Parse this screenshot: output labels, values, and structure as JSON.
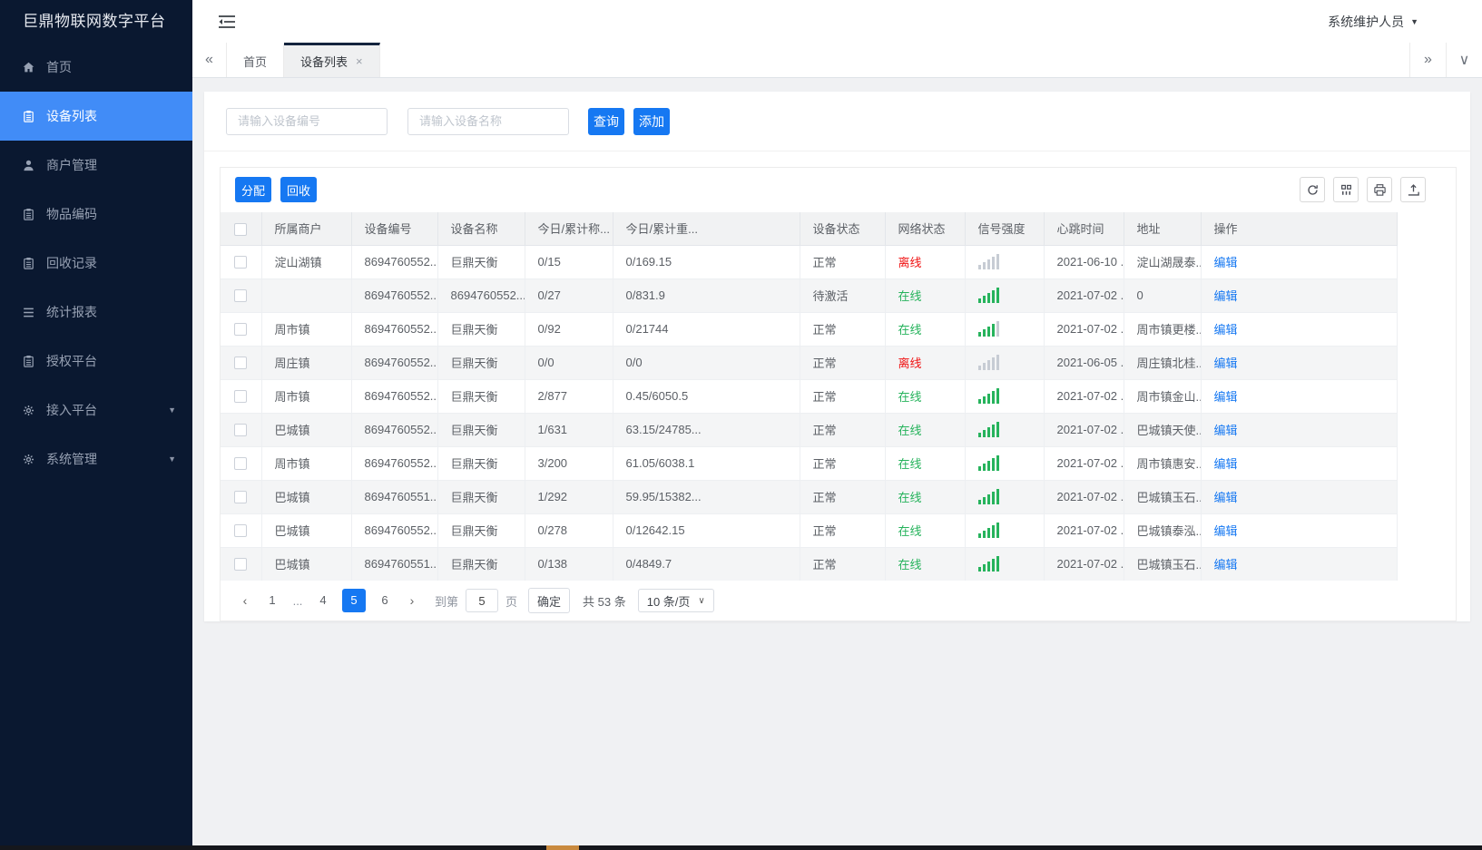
{
  "app_title": "巨鼎物联网数字平台",
  "header": {
    "user": "系统维护人员"
  },
  "glyphs": {
    "tabs_prev": "«",
    "tabs_next": "»",
    "tabs_menu": "∨",
    "page_prev": "‹",
    "page_next": "›",
    "caret_down": "▼",
    "close": "×",
    "select_caret": "∨"
  },
  "sidebar": {
    "items": [
      {
        "key": "home",
        "label": "首页",
        "icon": "home-icon",
        "active": false,
        "expandable": false
      },
      {
        "key": "device-list",
        "label": "设备列表",
        "icon": "clipboard-icon",
        "active": true,
        "expandable": false
      },
      {
        "key": "merchant-mgmt",
        "label": "商户管理",
        "icon": "user-icon",
        "active": false,
        "expandable": false
      },
      {
        "key": "item-code",
        "label": "物品编码",
        "icon": "clipboard-icon",
        "active": false,
        "expandable": false
      },
      {
        "key": "recycle-records",
        "label": "回收记录",
        "icon": "clipboard-icon",
        "active": false,
        "expandable": false
      },
      {
        "key": "stats-report",
        "label": "统计报表",
        "icon": "menu-icon",
        "active": false,
        "expandable": false
      },
      {
        "key": "auth-platform",
        "label": "授权平台",
        "icon": "clipboard-icon",
        "active": false,
        "expandable": false
      },
      {
        "key": "access-platform",
        "label": "接入平台",
        "icon": "gear-icon",
        "active": false,
        "expandable": true
      },
      {
        "key": "system-mgmt",
        "label": "系统管理",
        "icon": "gear-icon",
        "active": false,
        "expandable": true
      }
    ]
  },
  "tabs": [
    {
      "key": "home",
      "label": "首页",
      "active": false,
      "closable": false
    },
    {
      "key": "device-list",
      "label": "设备列表",
      "active": true,
      "closable": true
    }
  ],
  "search": {
    "device_no_placeholder": "请输入设备编号",
    "device_name_placeholder": "请输入设备名称",
    "query_label": "查询",
    "add_label": "添加"
  },
  "toolbar": {
    "assign_label": "分配",
    "recycle_label": "回收"
  },
  "table": {
    "columns": [
      "所属商户",
      "设备编号",
      "设备名称",
      "今日/累计称...",
      "今日/累计重...",
      "设备状态",
      "网络状态",
      "信号强度",
      "心跳时间",
      "地址",
      "操作"
    ],
    "edit_label": "编辑",
    "rows": [
      {
        "merchant": "淀山湖镇",
        "device_no": "8694760552...",
        "device_name": "巨鼎天衡",
        "today_count": "0/15",
        "today_weight": "0/169.15",
        "status": "正常",
        "network": "离线",
        "online": false,
        "signal": 0,
        "heartbeat": "2021-06-10 ...",
        "address": "淀山湖晟泰..."
      },
      {
        "merchant": "",
        "device_no": "8694760552...",
        "device_name": "8694760552...",
        "today_count": "0/27",
        "today_weight": "0/831.9",
        "status": "待激活",
        "network": "在线",
        "online": true,
        "signal": 5,
        "heartbeat": "2021-07-02 ...",
        "address": "0"
      },
      {
        "merchant": "周市镇",
        "device_no": "8694760552...",
        "device_name": "巨鼎天衡",
        "today_count": "0/92",
        "today_weight": "0/21744",
        "status": "正常",
        "network": "在线",
        "online": true,
        "signal": 4,
        "heartbeat": "2021-07-02 ...",
        "address": "周市镇更楼..."
      },
      {
        "merchant": "周庄镇",
        "device_no": "8694760552...",
        "device_name": "巨鼎天衡",
        "today_count": "0/0",
        "today_weight": "0/0",
        "status": "正常",
        "network": "离线",
        "online": false,
        "signal": 0,
        "heartbeat": "2021-06-05 ...",
        "address": "周庄镇北桂..."
      },
      {
        "merchant": "周市镇",
        "device_no": "8694760552...",
        "device_name": "巨鼎天衡",
        "today_count": "2/877",
        "today_weight": "0.45/6050.5",
        "status": "正常",
        "network": "在线",
        "online": true,
        "signal": 5,
        "heartbeat": "2021-07-02 ...",
        "address": "周市镇金山..."
      },
      {
        "merchant": "巴城镇",
        "device_no": "8694760552...",
        "device_name": "巨鼎天衡",
        "today_count": "1/631",
        "today_weight": "63.15/24785...",
        "status": "正常",
        "network": "在线",
        "online": true,
        "signal": 5,
        "heartbeat": "2021-07-02 ...",
        "address": "巴城镇天使..."
      },
      {
        "merchant": "周市镇",
        "device_no": "8694760552...",
        "device_name": "巨鼎天衡",
        "today_count": "3/200",
        "today_weight": "61.05/6038.1",
        "status": "正常",
        "network": "在线",
        "online": true,
        "signal": 5,
        "heartbeat": "2021-07-02 ...",
        "address": "周市镇惠安..."
      },
      {
        "merchant": "巴城镇",
        "device_no": "8694760551...",
        "device_name": "巨鼎天衡",
        "today_count": "1/292",
        "today_weight": "59.95/15382...",
        "status": "正常",
        "network": "在线",
        "online": true,
        "signal": 5,
        "heartbeat": "2021-07-02 ...",
        "address": "巴城镇玉石..."
      },
      {
        "merchant": "巴城镇",
        "device_no": "8694760552...",
        "device_name": "巨鼎天衡",
        "today_count": "0/278",
        "today_weight": "0/12642.15",
        "status": "正常",
        "network": "在线",
        "online": true,
        "signal": 5,
        "heartbeat": "2021-07-02 ...",
        "address": "巴城镇泰泓..."
      },
      {
        "merchant": "巴城镇",
        "device_no": "8694760551...",
        "device_name": "巨鼎天衡",
        "today_count": "0/138",
        "today_weight": "0/4849.7",
        "status": "正常",
        "network": "在线",
        "online": true,
        "signal": 5,
        "heartbeat": "2021-07-02 ...",
        "address": "巴城镇玉石..."
      }
    ]
  },
  "pagination": {
    "pages": [
      "1",
      "...",
      "4",
      "5",
      "6"
    ],
    "active": "5",
    "goto_label": "到第",
    "goto_value": "5",
    "page_label": "页",
    "confirm_label": "确定",
    "total_label": "共 53 条",
    "page_size": "10 条/页"
  },
  "colors": {
    "accent": "#1678f2",
    "sidebar_bg": "#0a1830",
    "sidebar_active": "#418cf7",
    "online_green": "#26b35c",
    "offline_red": "#f01414"
  }
}
